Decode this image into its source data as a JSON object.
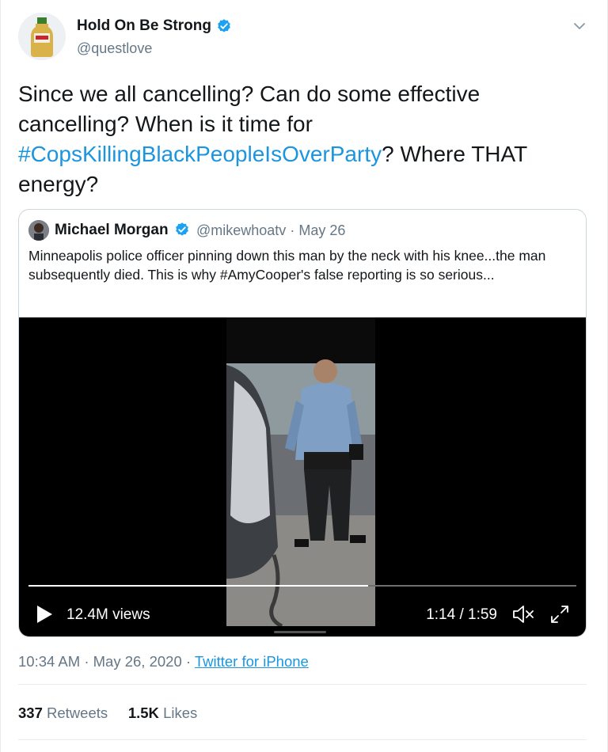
{
  "author": {
    "name": "Hold On Be Strong",
    "handle": "@questlove"
  },
  "tweet": {
    "text_before": "Since we all cancelling? Can do some effective cancelling? When is it time for ",
    "hashtag": "#CopsKillingBlackPeopleIsOverParty",
    "text_after": "? Where THAT energy?"
  },
  "quote": {
    "name": "Michael Morgan",
    "handle": "@mikewhoatv",
    "separator": "·",
    "date": "May 26",
    "text": "Minneapolis police officer pinning down this man by the neck with his knee...the man subsequently died. This is why #AmyCooper's false reporting is so serious...",
    "video": {
      "views": "12.4M views",
      "time": "1:14 / 1:59",
      "progress": 0.62
    }
  },
  "meta": {
    "time": "10:34 AM",
    "separator": "·",
    "date": "May 26, 2020",
    "source": "Twitter for iPhone"
  },
  "stats": {
    "retweets_count": "337",
    "retweets_label": "Retweets",
    "likes_count": "1.5K",
    "likes_label": "Likes"
  },
  "colors": {
    "link": "#1b95e0",
    "verified": "#1da1f2",
    "muted": "#657786"
  },
  "icons": [
    "verified-badge-icon",
    "chevron-down-icon",
    "play-icon",
    "mute-icon",
    "fullscreen-icon"
  ]
}
